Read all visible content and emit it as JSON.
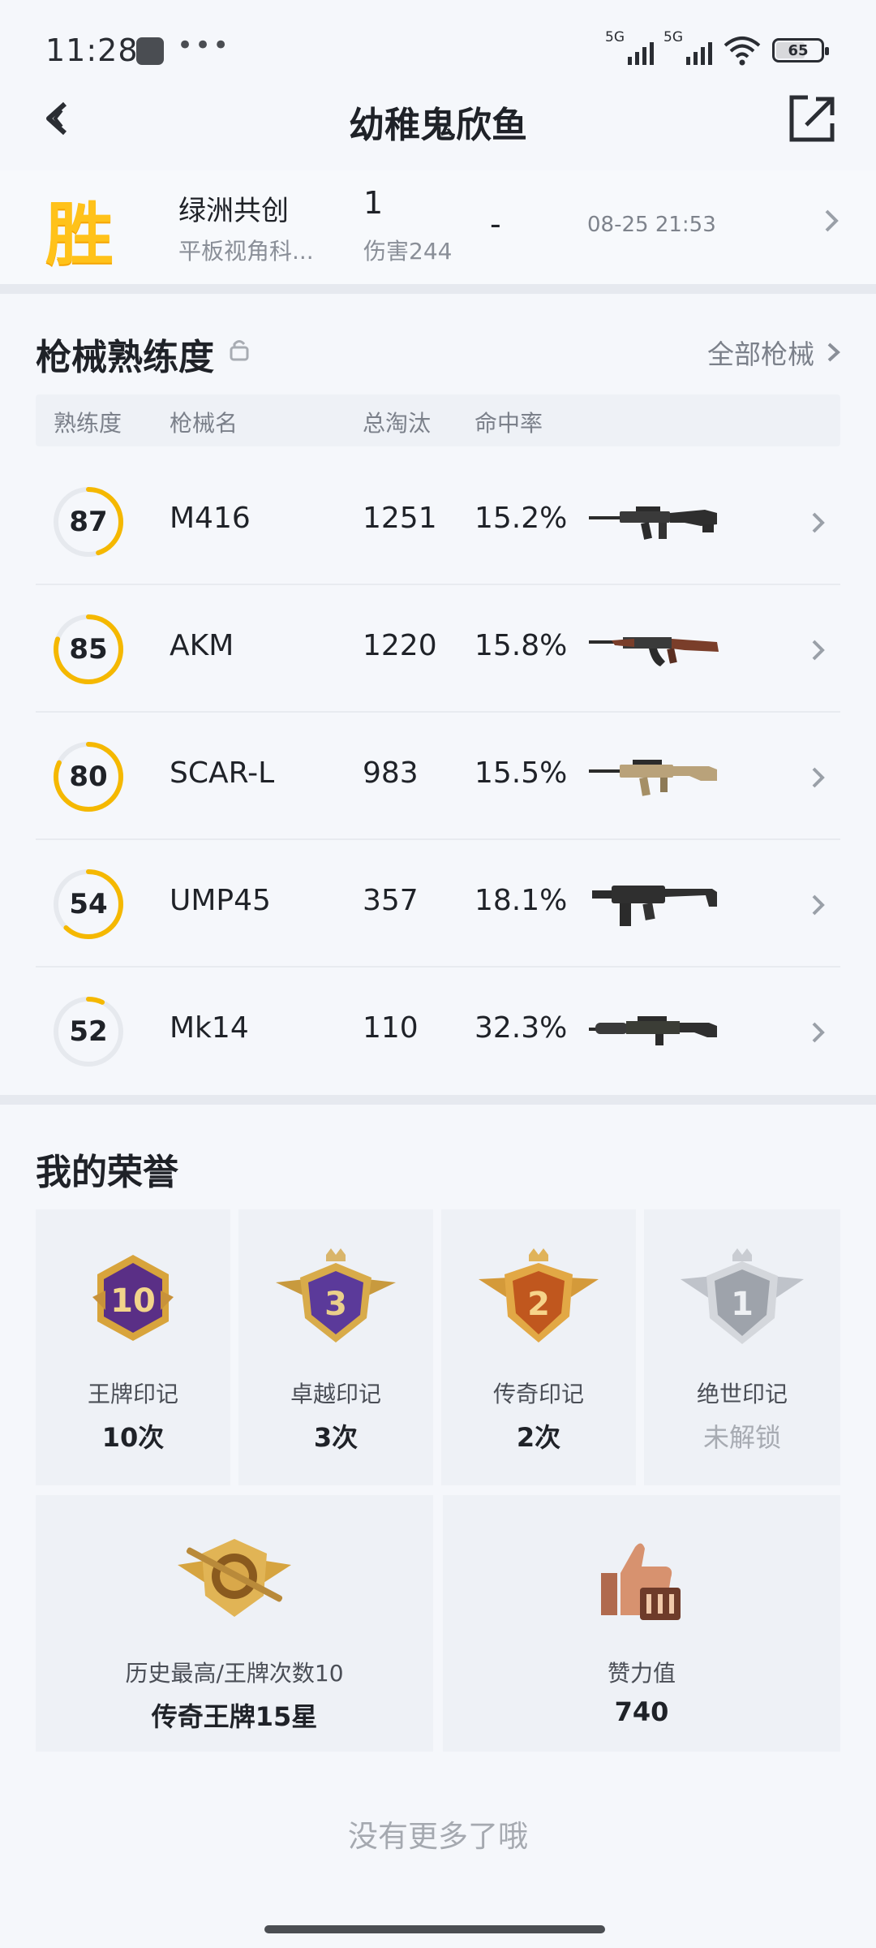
{
  "status": {
    "time": "11:28",
    "dots": "•••",
    "signal1": "5G",
    "signal2": "5G",
    "battery": "65"
  },
  "header": {
    "title": "幼稚鬼欣鱼"
  },
  "match": {
    "result": "胜",
    "name": "绿洲共创",
    "subtitle": "平板视角科...",
    "rank": "1",
    "damage": "伤害244",
    "dash": "-",
    "time": "08-25 21:53"
  },
  "weapons": {
    "title": "枪械熟练度",
    "all_link": "全部枪械",
    "headers": [
      "熟练度",
      "枪械名",
      "总淘汰",
      "命中率"
    ],
    "rows": [
      {
        "level": "87",
        "name": "M416",
        "kills": "1251",
        "accuracy": "15.2%",
        "progress": 0.45
      },
      {
        "level": "85",
        "name": "AKM",
        "kills": "1220",
        "accuracy": "15.8%",
        "progress": 0.8
      },
      {
        "level": "80",
        "name": "SCAR-L",
        "kills": "983",
        "accuracy": "15.5%",
        "progress": 0.82
      },
      {
        "level": "54",
        "name": "UMP45",
        "kills": "357",
        "accuracy": "18.1%",
        "progress": 0.62
      },
      {
        "level": "52",
        "name": "Mk14",
        "kills": "110",
        "accuracy": "32.3%",
        "progress": 0.07
      }
    ]
  },
  "honors": {
    "title": "我的荣誉",
    "tiles": [
      {
        "emblem": "10",
        "label": "王牌印记",
        "value": "10次"
      },
      {
        "emblem": "3",
        "label": "卓越印记",
        "value": "3次"
      },
      {
        "emblem": "2",
        "label": "传奇印记",
        "value": "2次"
      },
      {
        "emblem": "1",
        "label": "绝世印记",
        "value": "未解锁"
      }
    ],
    "big": [
      {
        "label": "历史最高/王牌次数10",
        "value": "传奇王牌15星"
      },
      {
        "label": "赞力值",
        "value": "740"
      }
    ]
  },
  "footer": {
    "note": "没有更多了哦"
  },
  "colors": {
    "accent": "#f5b800",
    "win": "#ffc21a",
    "text": "#1f2228",
    "muted": "#8a8f98",
    "bg": "#f5f7fb"
  }
}
